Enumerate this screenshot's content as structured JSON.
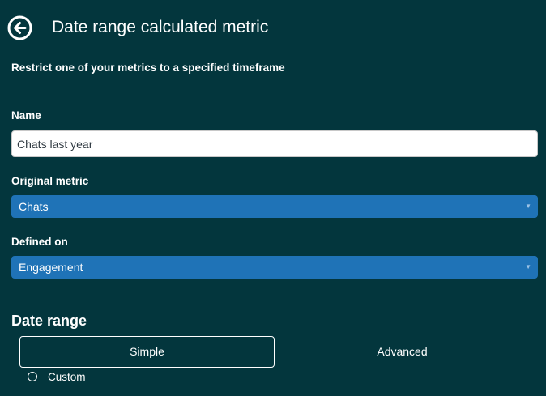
{
  "header": {
    "title": "Date range calculated metric",
    "back_icon": "arrow-left-circle-icon"
  },
  "description": "Restrict one of your metrics to a specified timeframe",
  "name_field": {
    "label": "Name",
    "value": "Chats last year"
  },
  "original_metric": {
    "label": "Original metric",
    "selected": "Chats"
  },
  "defined_on": {
    "label": "Defined on",
    "selected": "Engagement"
  },
  "date_range": {
    "heading": "Date range",
    "tabs": [
      {
        "label": "Simple",
        "active": true
      },
      {
        "label": "Advanced",
        "active": false
      }
    ],
    "option_label": "Custom"
  },
  "colors": {
    "background": "#03363d",
    "select_accent": "#1f73b7",
    "text": "#ffffff"
  }
}
